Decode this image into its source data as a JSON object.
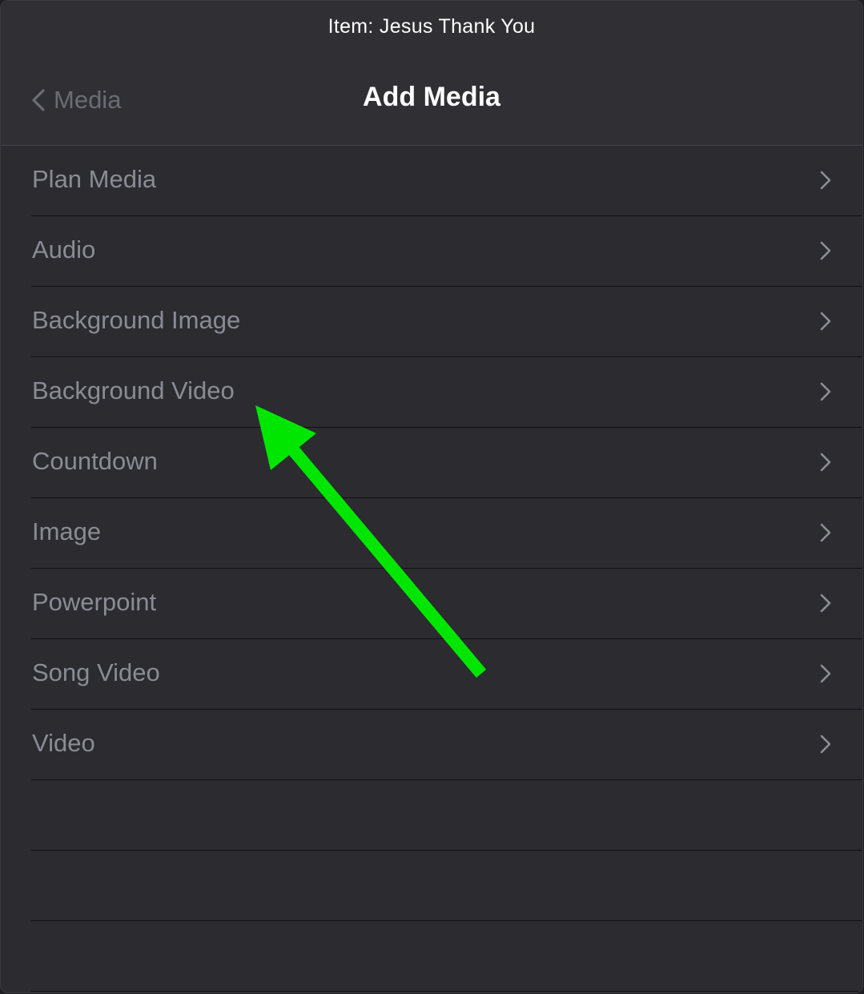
{
  "header": {
    "item_title": "Item: Jesus Thank You",
    "back_label": "Media",
    "page_title": "Add Media"
  },
  "list": {
    "items": [
      {
        "label": "Plan Media"
      },
      {
        "label": "Audio"
      },
      {
        "label": "Background Image"
      },
      {
        "label": "Background Video"
      },
      {
        "label": "Countdown"
      },
      {
        "label": "Image"
      },
      {
        "label": "Powerpoint"
      },
      {
        "label": "Song Video"
      },
      {
        "label": "Video"
      }
    ],
    "empty_rows": 3
  },
  "icons": {
    "back": "chevron-left-icon",
    "row": "chevron-right-icon"
  },
  "annotation": {
    "target": "Background Video",
    "color": "#00e600"
  },
  "colors": {
    "background": "#2b2b30",
    "header": "#2f2f34",
    "label": "#8b8b94",
    "back_label": "#6c6c74",
    "chevron": "#8e8e96",
    "title": "#ffffff"
  }
}
